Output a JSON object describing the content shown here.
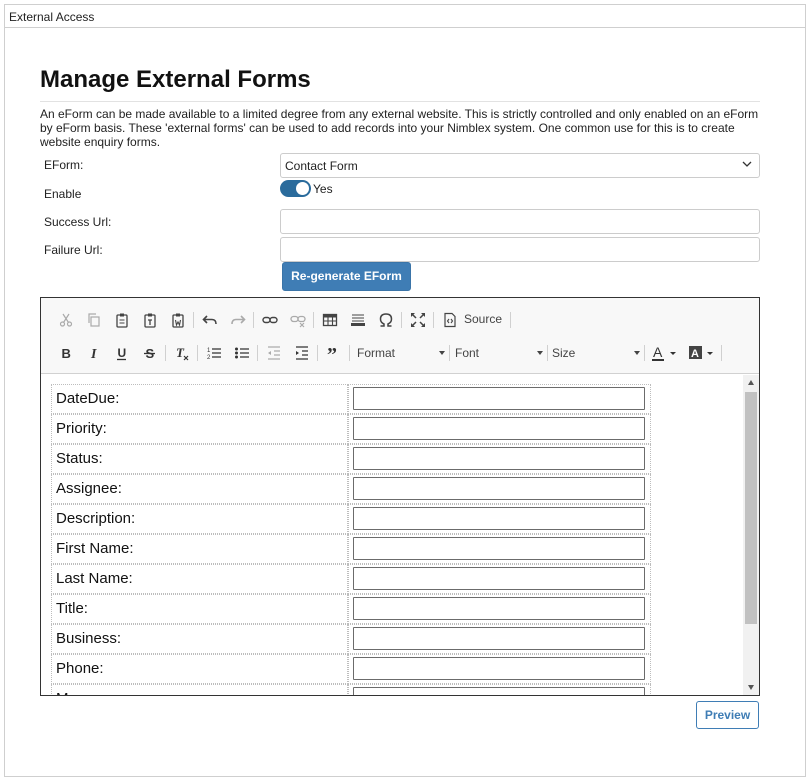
{
  "panel": {
    "header_title": "External Access"
  },
  "page": {
    "title": "Manage External Forms",
    "intro": "An eForm can be made available to a limited degree from any external website. This is strictly controlled and only enabled on an eForm by eForm basis. These 'external forms' can be used to add records into your Nimblex system. One common use for this is to create website enquiry forms."
  },
  "form": {
    "eform_label": "EForm:",
    "eform_selected": "Contact Form",
    "enable_label": "Enable",
    "enable_value": "Yes",
    "enable_on": true,
    "success_url_label": "Success Url:",
    "success_url_value": "",
    "failure_url_label": "Failure Url:",
    "failure_url_value": "",
    "regenerate_label": "Re-generate EForm"
  },
  "editor": {
    "toolbar": {
      "source_label": "Source",
      "format_label": "Format",
      "font_label": "Font",
      "size_label": "Size"
    },
    "rows": [
      {
        "label": "DateDue:"
      },
      {
        "label": "Priority:"
      },
      {
        "label": "Status:"
      },
      {
        "label": "Assignee:"
      },
      {
        "label": "Description:"
      },
      {
        "label": "First Name:"
      },
      {
        "label": "Last Name:"
      },
      {
        "label": "Title:"
      },
      {
        "label": "Business:"
      },
      {
        "label": "Phone:"
      },
      {
        "label": "M..."
      }
    ]
  },
  "preview_label": "Preview",
  "colors": {
    "accent": "#3f7db5",
    "toggle": "#2a6b9c"
  }
}
